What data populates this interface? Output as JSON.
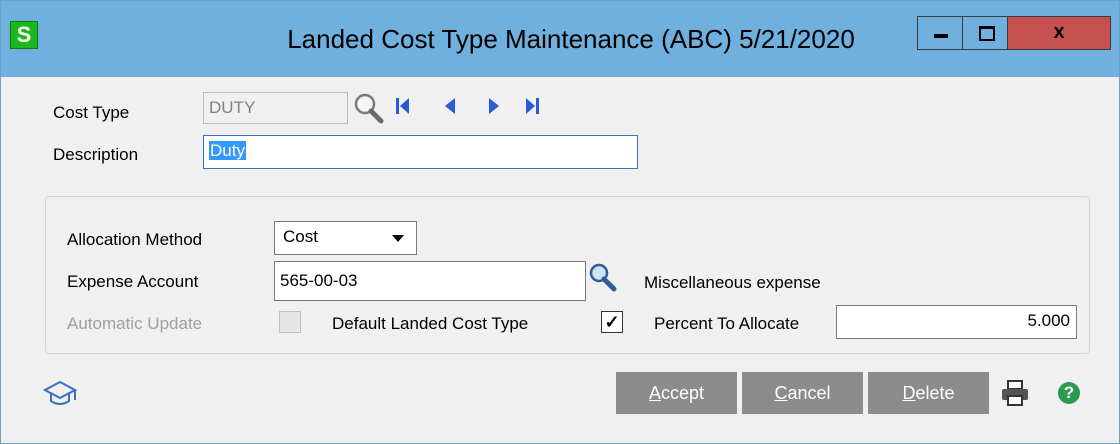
{
  "window": {
    "app_icon": "S",
    "title": "Landed Cost Type Maintenance (ABC) 5/21/2020",
    "close_label": "x"
  },
  "header": {
    "cost_type_label": "Cost Type",
    "cost_type_value": "DUTY",
    "description_label": "Description",
    "description_value": "Duty"
  },
  "group": {
    "allocation_method_label": "Allocation Method",
    "allocation_method_value": "Cost",
    "expense_account_label": "Expense Account",
    "expense_account_value": "565-00-03",
    "expense_account_desc": "Miscellaneous expense",
    "automatic_update_label": "Automatic Update",
    "default_landed_label": "Default Landed Cost Type",
    "default_landed_checked": "✓",
    "percent_label": "Percent To Allocate",
    "percent_value": "5.000"
  },
  "buttons": {
    "accept": {
      "underline": "A",
      "rest": "ccept"
    },
    "cancel": {
      "underline": "C",
      "rest": "ancel"
    },
    "delete": {
      "underline": "D",
      "rest": "elete"
    },
    "help": "?"
  },
  "icons": {
    "lookup": "magnifier-icon",
    "nav_first": "first-record-icon",
    "nav_prev": "previous-record-icon",
    "nav_next": "next-record-icon",
    "nav_last": "last-record-icon",
    "training": "graduation-cap-icon",
    "print": "printer-icon",
    "help": "help-icon"
  },
  "colors": {
    "titlebar": "#6fb0de",
    "close": "#c75050",
    "app_icon": "#1db81d",
    "nav_arrows": "#2a5bd7",
    "buttons": "#8c8c8c",
    "selection": "#3399ff"
  }
}
